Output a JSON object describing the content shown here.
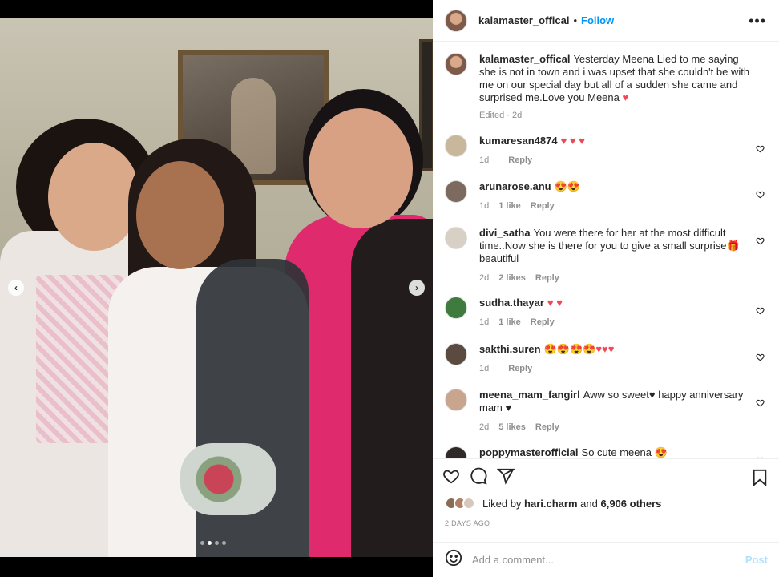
{
  "post": {
    "username": "kalamaster_offical",
    "separator": "•",
    "follow_label": "Follow",
    "more_icon": "more-horizontal-icon"
  },
  "caption": {
    "username": "kalamaster_offical",
    "text": "Yesterday Meena Lied to me saying she is not in town and i was upset that she couldn't be with me on our special day but all of a sudden she came and surprised me.Love you Meena",
    "emoji": "♥",
    "meta": "Edited · 2d"
  },
  "comments": [
    {
      "username": "kumaresan4874",
      "text": "",
      "emoji": "♥ ♥ ♥",
      "time": "1d",
      "likes": "",
      "reply": "Reply"
    },
    {
      "username": "arunarose.anu",
      "text": "",
      "emoji": "😍😍",
      "time": "1d",
      "likes": "1 like",
      "reply": "Reply"
    },
    {
      "username": "divi_satha",
      "text": "You were there for her at the most difficult time..Now she is there for you to give a small surprise🎁 beautiful",
      "emoji": "",
      "time": "2d",
      "likes": "2 likes",
      "reply": "Reply"
    },
    {
      "username": "sudha.thayar",
      "text": "",
      "emoji": "♥ ♥",
      "time": "1d",
      "likes": "1 like",
      "reply": "Reply"
    },
    {
      "username": "sakthi.suren",
      "text": "",
      "emoji": "😍😍😍😍♥♥♥",
      "time": "1d",
      "likes": "",
      "reply": "Reply"
    },
    {
      "username": "meena_mam_fangirl",
      "text": "Aww so sweet♥ happy anniversary mam ♥",
      "emoji": "",
      "time": "2d",
      "likes": "5 likes",
      "reply": "Reply"
    },
    {
      "username": "poppymasterofficial",
      "text": "So cute meena 😍",
      "emoji": "",
      "time": "",
      "likes": "",
      "reply": ""
    }
  ],
  "likes": {
    "prefix": "Liked by",
    "user": "hari.charm",
    "middle": "and",
    "others": "6,906 others"
  },
  "date": "2 DAYS AGO",
  "add_comment": {
    "placeholder": "Add a comment...",
    "post_label": "Post"
  },
  "carousel": {
    "prev": "‹",
    "next": "›",
    "slide_count": 4,
    "active_slide": 1
  }
}
